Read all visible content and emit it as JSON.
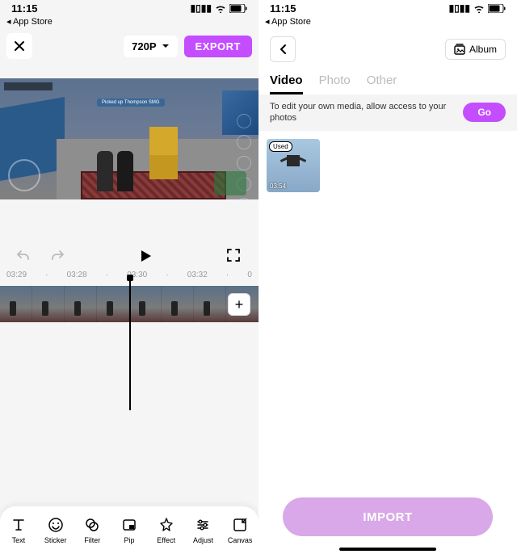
{
  "status": {
    "time": "11:15",
    "breadcrumb": "◂ App Store"
  },
  "editor": {
    "quality_label": "720P",
    "export_label": "EXPORT",
    "pickup_text": "Picked up Thompson SMG",
    "ruler": [
      "03:29",
      "·",
      "03:28",
      "·",
      "03:30",
      "·",
      "03:32",
      "·",
      "0"
    ],
    "tools": [
      {
        "key": "text",
        "label": "Text"
      },
      {
        "key": "sticker",
        "label": "Sticker"
      },
      {
        "key": "filter",
        "label": "Filter"
      },
      {
        "key": "pip",
        "label": "Pip"
      },
      {
        "key": "effect",
        "label": "Effect"
      },
      {
        "key": "adjust",
        "label": "Adjust"
      },
      {
        "key": "canvas",
        "label": "Canvas"
      }
    ]
  },
  "picker": {
    "album_label": "Album",
    "tabs": {
      "video": "Video",
      "photo": "Photo",
      "other": "Other"
    },
    "permission_msg": "To edit your own media, allow access to your photos",
    "go_label": "Go",
    "used_label": "Used",
    "item_duration": "03:54",
    "import_label": "IMPORT"
  }
}
